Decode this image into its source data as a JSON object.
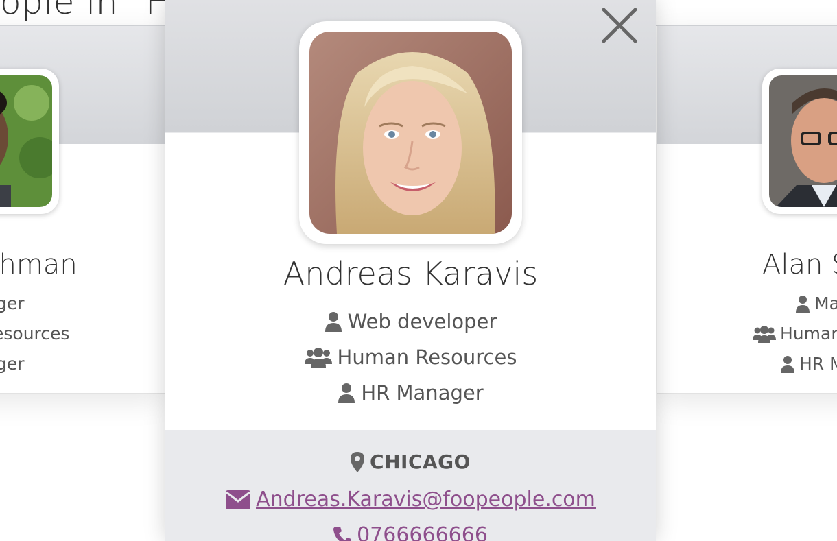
{
  "page": {
    "heading": "ople in \"Hu"
  },
  "left_card": {
    "name": "achman",
    "line1": "ger",
    "line2": "esources",
    "line3": "ger"
  },
  "right_card": {
    "name": "Alan Si",
    "line1": "Ma",
    "line2": "Human",
    "line3": "HR M"
  },
  "modal": {
    "close_label": "×",
    "name": "Andreas Karavis",
    "job_title": "Web developer",
    "department": "Human Resources",
    "manager": "HR Manager",
    "location": "CHICAGO",
    "email": "Andreas.Karavis@foopeople.com",
    "phone": "0766666666"
  },
  "colors": {
    "link": "#8e4f8c",
    "icon": "#666666",
    "header_band": "#d5d7db",
    "footer_band": "#e9eaed"
  },
  "icons": {
    "close": "close-icon",
    "job": "user-icon",
    "department": "users-icon",
    "manager": "user-icon",
    "location": "map-marker-icon",
    "email": "envelope-icon",
    "phone": "phone-icon"
  }
}
